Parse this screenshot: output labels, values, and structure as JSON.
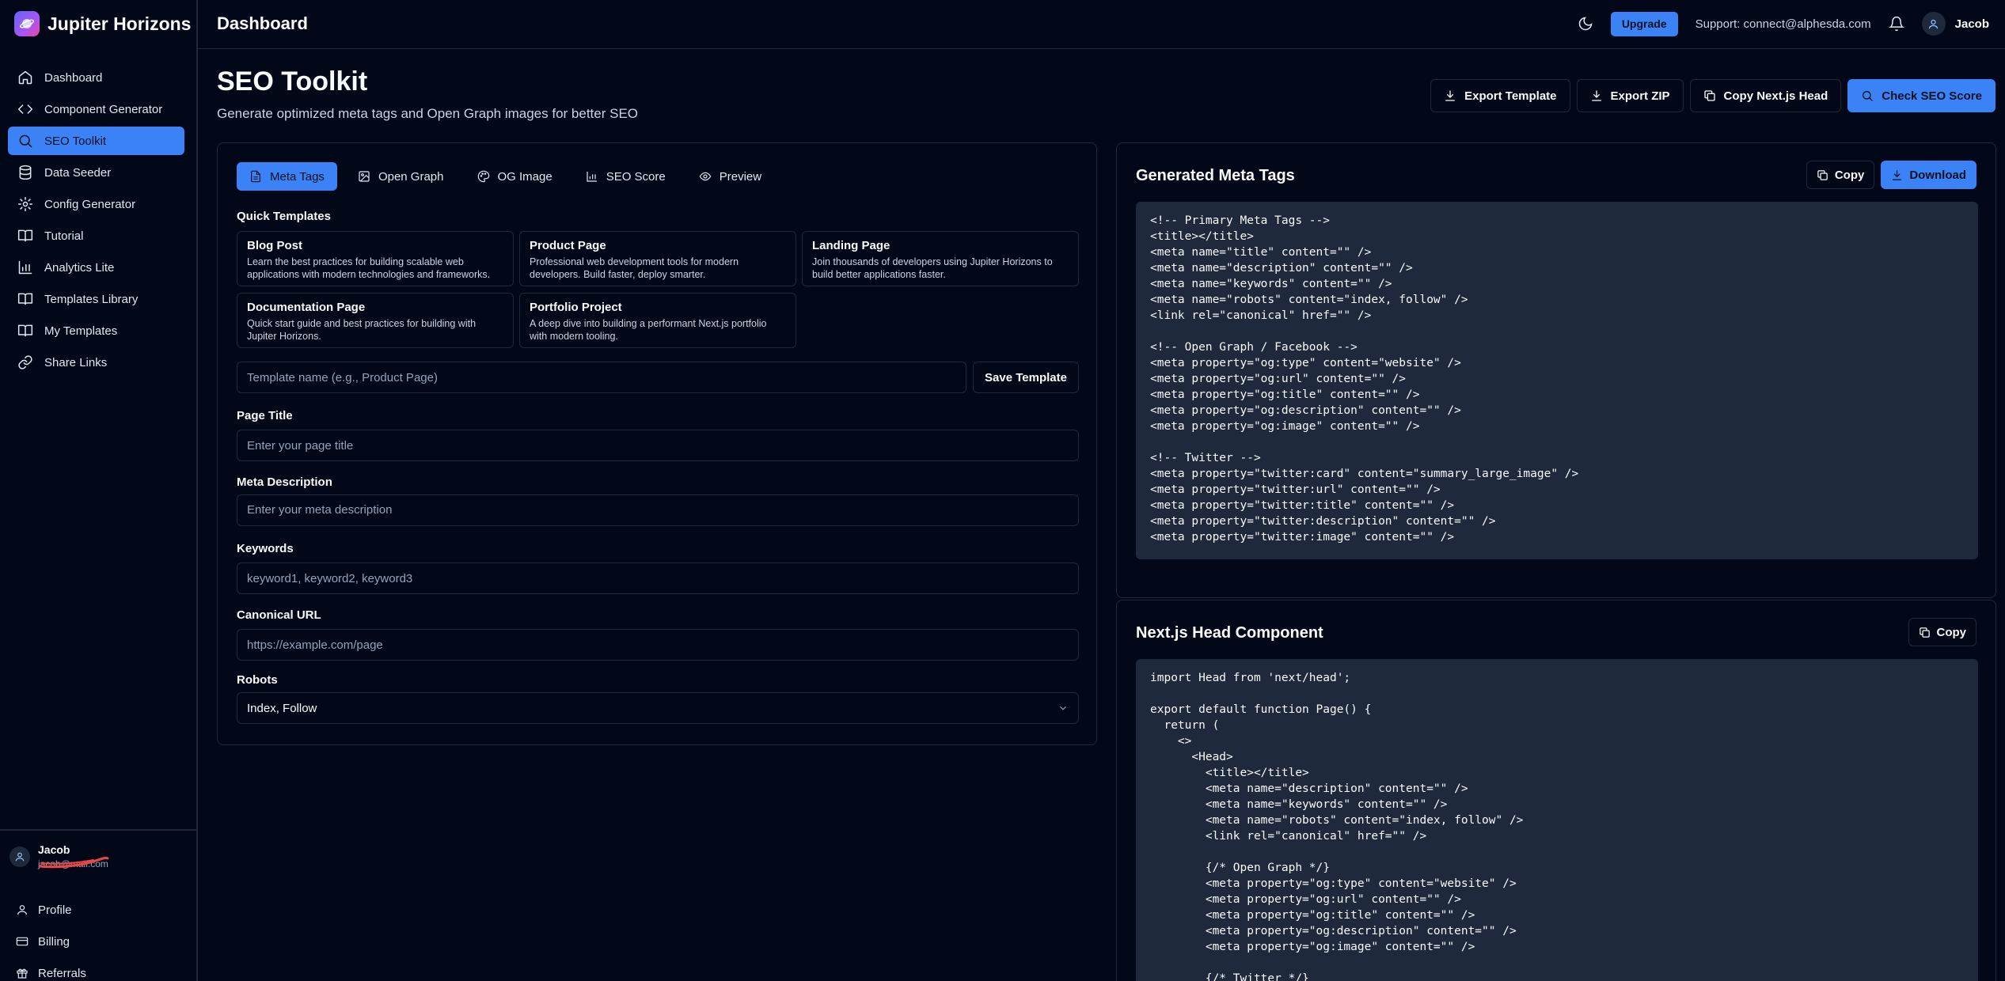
{
  "brand": {
    "name": "Jupiter Horizons"
  },
  "sidebar": {
    "items": [
      {
        "label": "Dashboard",
        "icon": "home-icon"
      },
      {
        "label": "Component Generator",
        "icon": "code-icon"
      },
      {
        "label": "SEO Toolkit",
        "icon": "search-icon",
        "active": true
      },
      {
        "label": "Data Seeder",
        "icon": "database-icon"
      },
      {
        "label": "Config Generator",
        "icon": "gear-icon"
      },
      {
        "label": "Tutorial",
        "icon": "book-open-icon"
      },
      {
        "label": "Analytics Lite",
        "icon": "bar-chart-icon"
      },
      {
        "label": "Templates Library",
        "icon": "book-icon"
      },
      {
        "label": "My Templates",
        "icon": "book-icon"
      },
      {
        "label": "Share Links",
        "icon": "link-icon"
      }
    ],
    "user": {
      "name": "Jacob",
      "email": "jacob@mail.com"
    },
    "bottom_links": [
      {
        "label": "Profile",
        "icon": "user-icon"
      },
      {
        "label": "Billing",
        "icon": "credit-card-icon"
      },
      {
        "label": "Referrals",
        "icon": "gift-icon"
      }
    ]
  },
  "topbar": {
    "title": "Dashboard",
    "upgrade_label": "Upgrade",
    "support": "Support: connect@alphesda.com",
    "user_name": "Jacob"
  },
  "page": {
    "title": "SEO Toolkit",
    "subtitle": "Generate optimized meta tags and Open Graph images for better SEO",
    "actions": {
      "export_template": "Export Template",
      "export_zip": "Export ZIP",
      "copy_next_head": "Copy Next.js Head",
      "check_seo": "Check SEO Score"
    }
  },
  "tabs": [
    {
      "label": "Meta Tags",
      "icon": "file-icon",
      "active": true
    },
    {
      "label": "Open Graph",
      "icon": "image-icon"
    },
    {
      "label": "OG Image",
      "icon": "palette-icon"
    },
    {
      "label": "SEO Score",
      "icon": "bar-chart-icon"
    },
    {
      "label": "Preview",
      "icon": "eye-icon"
    }
  ],
  "quick_templates": {
    "label": "Quick Templates",
    "items": [
      {
        "title": "Blog Post",
        "desc": "Learn the best practices for building scalable web applications with modern technologies and frameworks."
      },
      {
        "title": "Product Page",
        "desc": "Professional web development tools for modern developers. Build faster, deploy smarter."
      },
      {
        "title": "Landing Page",
        "desc": "Join thousands of developers using Jupiter Horizons to build better applications faster."
      },
      {
        "title": "Documentation Page",
        "desc": "Quick start guide and best practices for building with Jupiter Horizons."
      },
      {
        "title": "Portfolio Project",
        "desc": "A deep dive into building a performant Next.js portfolio with modern tooling."
      }
    ]
  },
  "template_name": {
    "placeholder": "Template name (e.g., Product Page)",
    "save_label": "Save Template"
  },
  "form": {
    "page_title": {
      "label": "Page Title",
      "placeholder": "Enter your page title"
    },
    "meta_description": {
      "label": "Meta Description",
      "placeholder": "Enter your meta description"
    },
    "keywords": {
      "label": "Keywords",
      "placeholder": "keyword1, keyword2, keyword3"
    },
    "canonical": {
      "label": "Canonical URL",
      "placeholder": "https://example.com/page"
    },
    "robots": {
      "label": "Robots",
      "value": "Index, Follow"
    }
  },
  "generated": {
    "title": "Generated Meta Tags",
    "copy_label": "Copy",
    "download_label": "Download",
    "code": "<!-- Primary Meta Tags -->\n<title></title>\n<meta name=\"title\" content=\"\" />\n<meta name=\"description\" content=\"\" />\n<meta name=\"keywords\" content=\"\" />\n<meta name=\"robots\" content=\"index, follow\" />\n<link rel=\"canonical\" href=\"\" />\n\n<!-- Open Graph / Facebook -->\n<meta property=\"og:type\" content=\"website\" />\n<meta property=\"og:url\" content=\"\" />\n<meta property=\"og:title\" content=\"\" />\n<meta property=\"og:description\" content=\"\" />\n<meta property=\"og:image\" content=\"\" />\n\n<!-- Twitter -->\n<meta property=\"twitter:card\" content=\"summary_large_image\" />\n<meta property=\"twitter:url\" content=\"\" />\n<meta property=\"twitter:title\" content=\"\" />\n<meta property=\"twitter:description\" content=\"\" />\n<meta property=\"twitter:image\" content=\"\" />"
  },
  "nextjs": {
    "title": "Next.js Head Component",
    "copy_label": "Copy",
    "code": "import Head from 'next/head';\n\nexport default function Page() {\n  return (\n    <>\n      <Head>\n        <title></title>\n        <meta name=\"description\" content=\"\" />\n        <meta name=\"keywords\" content=\"\" />\n        <meta name=\"robots\" content=\"index, follow\" />\n        <link rel=\"canonical\" href=\"\" />\n\n        {/* Open Graph */}\n        <meta property=\"og:type\" content=\"website\" />\n        <meta property=\"og:url\" content=\"\" />\n        <meta property=\"og:title\" content=\"\" />\n        <meta property=\"og:description\" content=\"\" />\n        <meta property=\"og:image\" content=\"\" />\n\n        {/* Twitter */}"
  },
  "colors": {
    "accent": "#3b82f6",
    "background": "#020817",
    "border": "#1e293b",
    "code_bg": "#1e293b"
  }
}
